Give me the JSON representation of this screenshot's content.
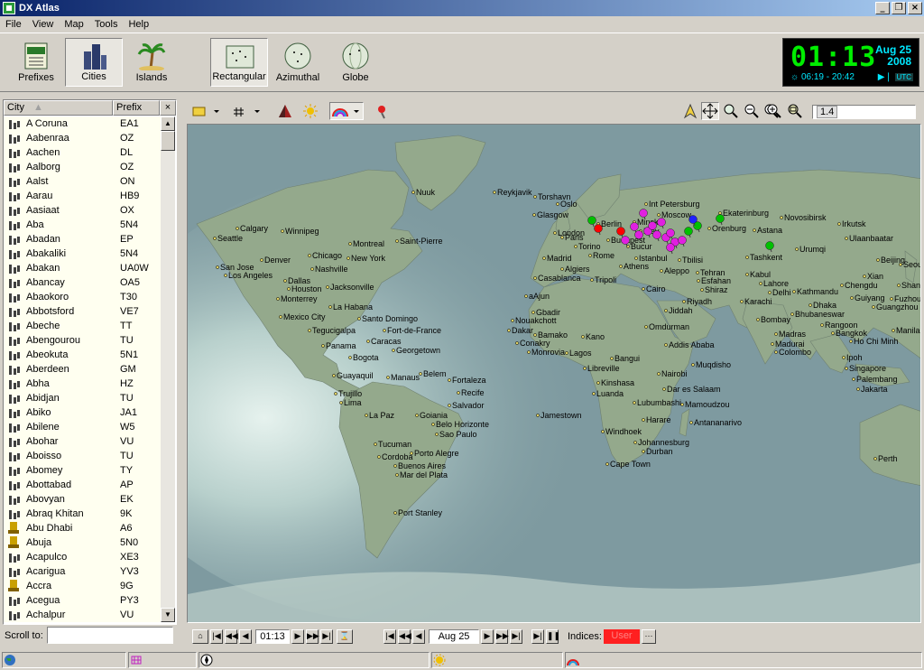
{
  "window": {
    "title": "DX Atlas"
  },
  "menu": [
    "File",
    "View",
    "Map",
    "Tools",
    "Help"
  ],
  "toolbar": {
    "prefixes": "Prefixes",
    "cities": "Cities",
    "islands": "Islands",
    "rectangular": "Rectangular",
    "azimuthal": "Azimuthal",
    "globe": "Globe"
  },
  "clock": {
    "time": "01:13",
    "date_day": "Aug 25",
    "date_year": "2008",
    "sun_times": "06:19 - 20:42",
    "utc_label": "UTC"
  },
  "citylist": {
    "col_city": "City",
    "col_prefix": "Prefix",
    "rows": [
      {
        "city": "A Coruna",
        "prefix": "EA1",
        "icon": "city"
      },
      {
        "city": "Aabenraa",
        "prefix": "OZ",
        "icon": "city"
      },
      {
        "city": "Aachen",
        "prefix": "DL",
        "icon": "city"
      },
      {
        "city": "Aalborg",
        "prefix": "OZ",
        "icon": "city"
      },
      {
        "city": "Aalst",
        "prefix": "ON",
        "icon": "city"
      },
      {
        "city": "Aarau",
        "prefix": "HB9",
        "icon": "city"
      },
      {
        "city": "Aasiaat",
        "prefix": "OX",
        "icon": "city"
      },
      {
        "city": "Aba",
        "prefix": "5N4",
        "icon": "city"
      },
      {
        "city": "Abadan",
        "prefix": "EP",
        "icon": "city"
      },
      {
        "city": "Abakaliki",
        "prefix": "5N4",
        "icon": "city"
      },
      {
        "city": "Abakan",
        "prefix": "UA0W",
        "icon": "city"
      },
      {
        "city": "Abancay",
        "prefix": "OA5",
        "icon": "city"
      },
      {
        "city": "Abaokoro",
        "prefix": "T30",
        "icon": "city"
      },
      {
        "city": "Abbotsford",
        "prefix": "VE7",
        "icon": "city"
      },
      {
        "city": "Abeche",
        "prefix": "TT",
        "icon": "city"
      },
      {
        "city": "Abengourou",
        "prefix": "TU",
        "icon": "city"
      },
      {
        "city": "Abeokuta",
        "prefix": "5N1",
        "icon": "city"
      },
      {
        "city": "Aberdeen",
        "prefix": "GM",
        "icon": "city"
      },
      {
        "city": "Abha",
        "prefix": "HZ",
        "icon": "city"
      },
      {
        "city": "Abidjan",
        "prefix": "TU",
        "icon": "city"
      },
      {
        "city": "Abiko",
        "prefix": "JA1",
        "icon": "city"
      },
      {
        "city": "Abilene",
        "prefix": "W5",
        "icon": "city"
      },
      {
        "city": "Abohar",
        "prefix": "VU",
        "icon": "city"
      },
      {
        "city": "Aboisso",
        "prefix": "TU",
        "icon": "city"
      },
      {
        "city": "Abomey",
        "prefix": "TY",
        "icon": "city"
      },
      {
        "city": "Abottabad",
        "prefix": "AP",
        "icon": "city"
      },
      {
        "city": "Abovyan",
        "prefix": "EK",
        "icon": "city"
      },
      {
        "city": "Abraq Khitan",
        "prefix": "9K",
        "icon": "city"
      },
      {
        "city": "Abu Dhabi",
        "prefix": "A6",
        "icon": "capital"
      },
      {
        "city": "Abuja",
        "prefix": "5N0",
        "icon": "capital"
      },
      {
        "city": "Acapulco",
        "prefix": "XE3",
        "icon": "city"
      },
      {
        "city": "Acarigua",
        "prefix": "YV3",
        "icon": "city"
      },
      {
        "city": "Accra",
        "prefix": "9G",
        "icon": "capital"
      },
      {
        "city": "Acegua",
        "prefix": "PY3",
        "icon": "city"
      },
      {
        "city": "Achalpur",
        "prefix": "VU",
        "icon": "city"
      }
    ]
  },
  "scroll_to_label": "Scroll to:",
  "zoom_value": "1.4",
  "map_labels": [
    "Nuuk",
    "Reykjavik",
    "Torshavn",
    "Oslo",
    "Glasgow",
    "Int Petersburg",
    "Moscow",
    "Ekaterinburg",
    "Novosibirsk",
    "Irkutsk",
    "Ulaanbaatar",
    "Calgary",
    "Winnipeg",
    "Seattle",
    "Montreal",
    "Saint-Pierre",
    "Denver",
    "Chicago",
    "New York",
    "San Jose",
    "Los Angeles",
    "Nashville",
    "Dallas",
    "Houston",
    "Jacksonville",
    "Monterrey",
    "La Habana",
    "Mexico City",
    "Santo Domingo",
    "Tegucigalpa",
    "Fort-de-France",
    "Panama",
    "Caracas",
    "Georgetown",
    "Bogota",
    "Guayaquil",
    "Manaus",
    "Belem",
    "Fortaleza",
    "Trujillo",
    "Lima",
    "Recife",
    "La Paz",
    "Goiania",
    "Salvador",
    "Belo Horizonte",
    "Sao Paulo",
    "Tucuman",
    "Porto Alegre",
    "Cordoba",
    "Buenos Aires",
    "Mar del Plata",
    "Port Stanley",
    "Jamestown",
    "London",
    "Paris",
    "Berlin",
    "Minsk",
    "Kiev",
    "Budapest",
    "Torino",
    "Rome",
    "Madrid",
    "Algiers",
    "Bucur",
    "Istanbul",
    "Athens",
    "Tbilisi",
    "Tashkent",
    "Astana",
    "Urumqi",
    "Orenburg",
    "Casablanca",
    "Tripoli",
    "Cairo",
    "Aleppo",
    "Tehran",
    "Esfahan",
    "Shiraz",
    "Kabul",
    "Lahore",
    "Delhi",
    "Karachi",
    "Kathmandu",
    "Dhaka",
    "Chengdu",
    "Beijing",
    "Xian",
    "Seoul",
    "Shanghai",
    "Guiyang",
    "Fuzhou",
    "Guangzhou",
    "Rangoon",
    "Manila",
    "Bangkok",
    "Ho Chi Minh",
    "Bhubaneswar",
    "Bombay",
    "Madras",
    "Madurai",
    "Colombo",
    "Ipoh",
    "Singapore",
    "Palembang",
    "Jakarta",
    "Riyadh",
    "Jiddah",
    "Omdurman",
    "Addis Ababa",
    "Muqdisho",
    "Nairobi",
    "Dar es Salaam",
    "Mamoudzou",
    "Antananarivo",
    "Lubumbashi",
    "Harare",
    "Kinshasa",
    "Luanda",
    "Libreville",
    "Bangui",
    "Kano",
    "Nouakchott",
    "Dakar",
    "Bamako",
    "Conakry",
    "Monrovia",
    "Lagos",
    "Gbadir",
    "aAjun",
    "Windhoek",
    "Johannesburg",
    "Durban",
    "Cape Town",
    "Perth"
  ],
  "bottom": {
    "time": "01:13",
    "date": "Aug 25",
    "indices_label": "Indices:",
    "indices_value": "User"
  },
  "colors": {
    "ocean": "#7e9aa0",
    "land": "#94a98c",
    "day_ocean": "#b8d4d0",
    "clock_green": "#00ee00",
    "clock_cyan": "#00e8ff"
  }
}
